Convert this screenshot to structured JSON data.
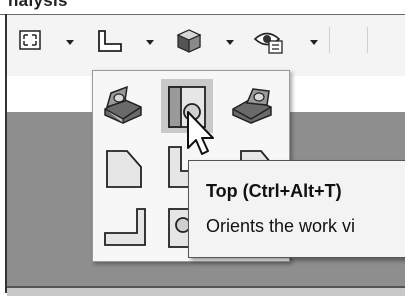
{
  "ribbon": {
    "active_tab_label": "nalysis"
  },
  "toolbar": {
    "tools": [
      {
        "icon": "zoom-to-fit-icon",
        "has_dropdown": true
      },
      {
        "icon": "view-orientation-icon",
        "has_dropdown": true,
        "open": true
      },
      {
        "icon": "display-style-icon",
        "has_dropdown": true
      },
      {
        "icon": "hide-show-items-icon",
        "has_dropdown": true
      }
    ]
  },
  "view_orientation_flyout": {
    "options": [
      {
        "icon": "isometric-view-icon"
      },
      {
        "icon": "top-view-icon",
        "selected": true
      },
      {
        "icon": "trimetric-view-icon"
      },
      {
        "icon": "front-view-icon"
      },
      {
        "icon": "right-view-icon"
      },
      {
        "icon": "left-view-icon"
      },
      {
        "icon": "bottom-view-icon"
      },
      {
        "icon": "back-view-icon"
      }
    ]
  },
  "tooltip": {
    "title": "Top (Ctrl+Alt+T)",
    "description": "Orients the work vi"
  },
  "colors": {
    "toolbar_bg": "#f4f4f4",
    "viewport_bg": "#8e8e8e",
    "selected_button_bg": "#c9c9c9",
    "tooltip_bg": "#f3f3f3"
  }
}
